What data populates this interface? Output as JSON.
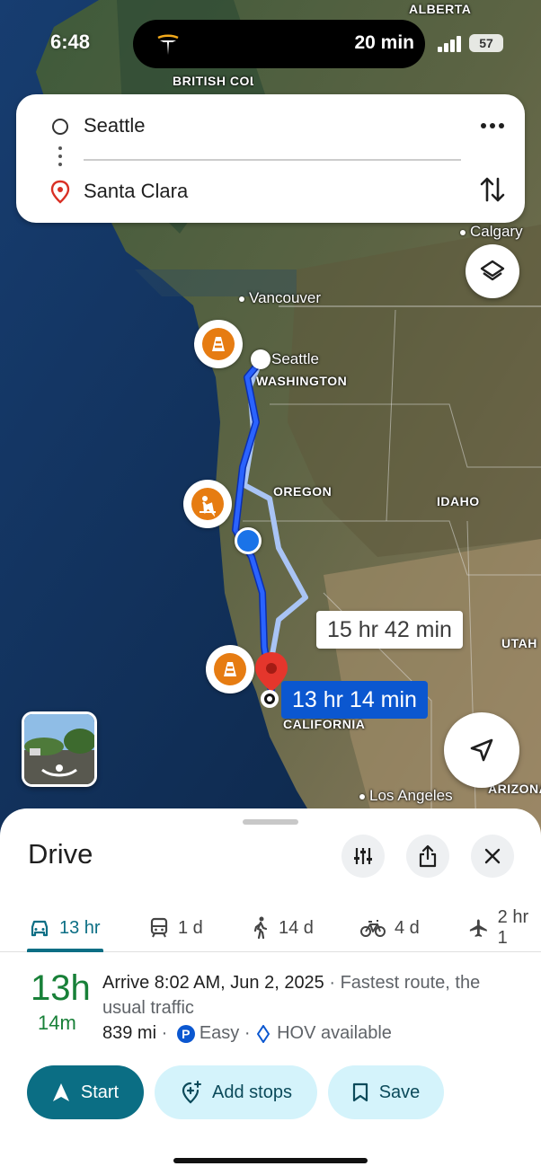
{
  "status_bar": {
    "time": "6:48",
    "live_activity_text": "20 min",
    "battery": "57"
  },
  "search": {
    "origin": "Seattle",
    "destination": "Santa Clara"
  },
  "map": {
    "labels": {
      "alberta": "ALBERTA",
      "british_columbia": "BRITISH COLUMBIA",
      "calgary": "Calgary",
      "vancouver": "Vancouver",
      "seattle": "Seattle",
      "washington": "WASHINGTON",
      "oregon": "OREGON",
      "idaho": "IDAHO",
      "utah": "UTAH",
      "california": "CALIFORNIA",
      "los_angeles": "Los Angeles",
      "arizona": "ARIZONA"
    },
    "routes": {
      "main_time": "13 hr 14 min",
      "alt_time": "15 hr 42 min"
    },
    "colors": {
      "route_main": "#1a4fe0",
      "route_alt": "#a9c4f5",
      "hazard": "#e67c12",
      "destination_pin": "#e5362c"
    }
  },
  "sheet": {
    "title": "Drive",
    "tabs": [
      {
        "icon": "car-icon",
        "label": "13 hr",
        "active": true
      },
      {
        "icon": "train-icon",
        "label": "1 d"
      },
      {
        "icon": "walk-icon",
        "label": "14 d"
      },
      {
        "icon": "bike-icon",
        "label": "4 d"
      },
      {
        "icon": "plane-icon",
        "label": "2 hr 1"
      }
    ],
    "duration_hours": "13h",
    "duration_minutes": "14m",
    "arrive_main": "Arrive 8:02 AM, Jun 2, 2025",
    "arrive_note": " · Fastest route, the usual traffic",
    "distance": "839 mi",
    "sep1": " · ",
    "parking_badge": "P",
    "parking": "Easy",
    "sep2": " · ",
    "hov": "HOV available",
    "buttons": {
      "start": "Start",
      "add_stops": "Add stops",
      "save": "Save"
    }
  }
}
